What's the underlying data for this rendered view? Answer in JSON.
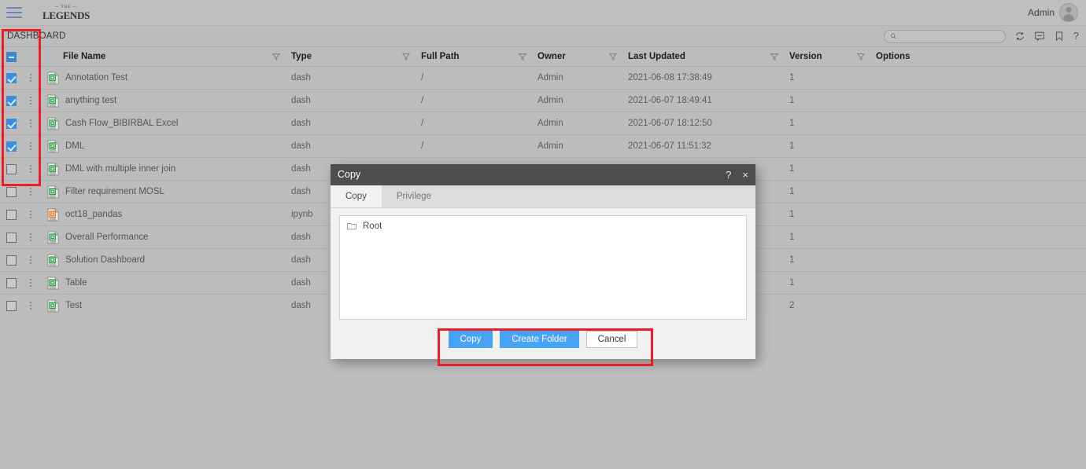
{
  "topbar": {
    "menu_icon": "hamburger-menu-icon",
    "brand_sup": "— THE —",
    "brand_main": "LEGENDS",
    "user_label": "Admin",
    "avatar_icon": "user-avatar-icon"
  },
  "subbar": {
    "tab_label": "DASHBOARD",
    "search": {
      "value": "",
      "placeholder": "",
      "icon": "search-icon"
    },
    "tools": [
      {
        "name": "refresh-icon",
        "title": "Refresh"
      },
      {
        "name": "comment-icon",
        "title": "Comments"
      },
      {
        "name": "bookmark-icon",
        "title": "Bookmark"
      },
      {
        "name": "help-icon",
        "title": "?"
      }
    ]
  },
  "table": {
    "select_all_state": "indeterminate",
    "columns": [
      {
        "key": "file_name",
        "label": "File Name",
        "filter": true
      },
      {
        "key": "type",
        "label": "Type",
        "filter": true
      },
      {
        "key": "full_path",
        "label": "Full Path",
        "filter": true
      },
      {
        "key": "owner",
        "label": "Owner",
        "filter": true
      },
      {
        "key": "last_updated",
        "label": "Last Updated",
        "filter": true
      },
      {
        "key": "version",
        "label": "Version",
        "filter": true
      },
      {
        "key": "options",
        "label": "Options",
        "filter": false
      }
    ],
    "rows": [
      {
        "checked": true,
        "icon": "dash-file-icon",
        "file_name": "Annotation Test",
        "type": "dash",
        "full_path": "/",
        "owner": "Admin",
        "last_updated": "2021-06-08 17:38:49",
        "version": "1",
        "options": ""
      },
      {
        "checked": true,
        "icon": "dash-file-icon",
        "file_name": "anything test",
        "type": "dash",
        "full_path": "/",
        "owner": "Admin",
        "last_updated": "2021-06-07 18:49:41",
        "version": "1",
        "options": ""
      },
      {
        "checked": true,
        "icon": "dash-file-icon",
        "file_name": "Cash Flow_BIBIRBAL Excel",
        "type": "dash",
        "full_path": "/",
        "owner": "Admin",
        "last_updated": "2021-06-07 18:12:50",
        "version": "1",
        "options": ""
      },
      {
        "checked": true,
        "icon": "dash-file-icon",
        "file_name": "DML",
        "type": "dash",
        "full_path": "/",
        "owner": "Admin",
        "last_updated": "2021-06-07 11:51:32",
        "version": "1",
        "options": ""
      },
      {
        "checked": false,
        "icon": "dash-file-icon",
        "file_name": "DML with multiple inner join",
        "type": "dash",
        "full_path": "",
        "owner": "",
        "last_updated": "",
        "version": "1",
        "options": ""
      },
      {
        "checked": false,
        "icon": "dash-file-icon",
        "file_name": "Filter requirement MOSL",
        "type": "dash",
        "full_path": "",
        "owner": "",
        "last_updated": "",
        "version": "1",
        "options": ""
      },
      {
        "checked": false,
        "icon": "ipynb-file-icon",
        "file_name": "oct18_pandas",
        "type": "ipynb",
        "full_path": "",
        "owner": "",
        "last_updated": "",
        "version": "1",
        "options": ""
      },
      {
        "checked": false,
        "icon": "dash-file-icon",
        "file_name": "Overall Performance",
        "type": "dash",
        "full_path": "",
        "owner": "",
        "last_updated": "",
        "version": "1",
        "options": ""
      },
      {
        "checked": false,
        "icon": "dash-file-icon",
        "file_name": "Solution Dashboard",
        "type": "dash",
        "full_path": "",
        "owner": "",
        "last_updated": "",
        "version": "1",
        "options": ""
      },
      {
        "checked": false,
        "icon": "dash-file-icon",
        "file_name": "Table",
        "type": "dash",
        "full_path": "",
        "owner": "",
        "last_updated": "",
        "version": "1",
        "options": ""
      },
      {
        "checked": false,
        "icon": "dash-file-icon",
        "file_name": "Test",
        "type": "dash",
        "full_path": "",
        "owner": "",
        "last_updated": "",
        "version": "2",
        "options": ""
      }
    ]
  },
  "modal": {
    "title": "Copy",
    "help_label": "?",
    "close_label": "×",
    "tabs": [
      {
        "label": "Copy",
        "active": true
      },
      {
        "label": "Privilege",
        "active": false
      }
    ],
    "tree": [
      {
        "label": "Root",
        "icon": "folder-icon"
      }
    ],
    "buttons": [
      {
        "label": "Copy",
        "style": "primary"
      },
      {
        "label": "Create Folder",
        "style": "primary"
      },
      {
        "label": "Cancel",
        "style": "default"
      }
    ]
  },
  "annotations": {
    "accent_color": "#ee1c25",
    "boxes": [
      {
        "name": "checkbox-column-highlight"
      },
      {
        "name": "dialog-buttons-highlight"
      }
    ]
  },
  "colors": {
    "page_background": "#bdbdbd",
    "primary_button": "#47a3f3",
    "checkbox_checked": "#3b8ede",
    "modal_titlebar": "#4e4e4e",
    "annotation": "#ee1c25"
  }
}
